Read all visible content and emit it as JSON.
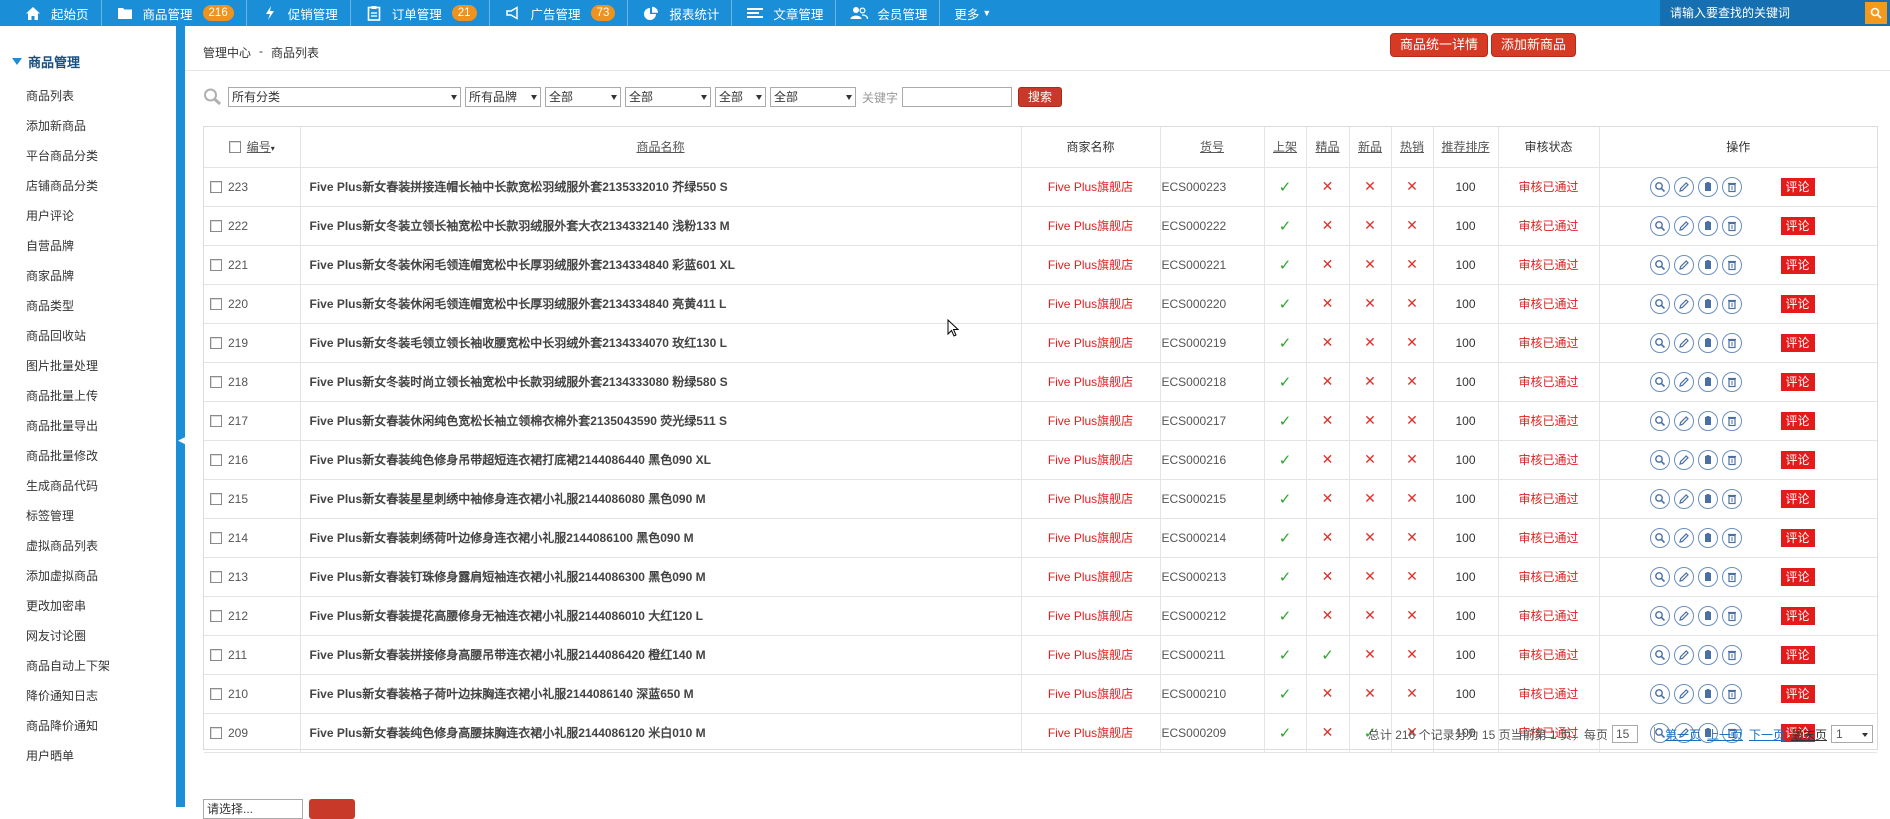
{
  "nav": {
    "items": [
      {
        "label": "起始页",
        "icon": "home-icon"
      },
      {
        "label": "商品管理",
        "icon": "folder-icon",
        "badge": "216"
      },
      {
        "label": "促销管理",
        "icon": "lightning-icon"
      },
      {
        "label": "订单管理",
        "icon": "clipboard-icon",
        "badge": "21"
      },
      {
        "label": "广告管理",
        "icon": "megaphone-icon",
        "badge": "73"
      },
      {
        "label": "报表统计",
        "icon": "pie-chart-icon"
      },
      {
        "label": "文章管理",
        "icon": "list-icon"
      },
      {
        "label": "会员管理",
        "icon": "users-icon"
      },
      {
        "label": "更多",
        "icon": "caret-down-icon"
      }
    ],
    "search_placeholder": "请输入要查找的关键词"
  },
  "sidebar": {
    "title": "商品管理",
    "items": [
      "商品列表",
      "添加新商品",
      "平台商品分类",
      "店铺商品分类",
      "用户评论",
      "自营品牌",
      "商家品牌",
      "商品类型",
      "商品回收站",
      "图片批量处理",
      "商品批量上传",
      "商品批量导出",
      "商品批量修改",
      "生成商品代码",
      "标签管理",
      "虚拟商品列表",
      "添加虚拟商品",
      "更改加密串",
      "网友讨论圈",
      "商品自动上下架",
      "降价通知日志",
      "商品降价通知",
      "用户晒单"
    ]
  },
  "breadcrumb": {
    "root": "管理中心",
    "sep": "-",
    "current": "商品列表"
  },
  "actions": {
    "detail": "商品统一详情",
    "add": "添加新商品"
  },
  "filters": {
    "category": "所有分类",
    "brand": "所有品牌",
    "f3": "全部",
    "f4": "全部",
    "f5": "全部",
    "f6": "全部",
    "keyword_label": "关键字",
    "search": "搜索"
  },
  "table": {
    "headers": {
      "id": "编号",
      "name": "商品名称",
      "shop": "商家名称",
      "sn": "货号",
      "onsale": "上架",
      "best": "精品",
      "new": "新品",
      "hot": "热销",
      "sort": "推荐排序",
      "audit": "审核状态",
      "ops": "操作"
    },
    "comment_label": "评论",
    "rows": [
      {
        "id": "223",
        "name": "Five Plus新女春装拼接连帽长袖中长款宽松羽绒服外套2135332010 芥绿550 S",
        "shop": "Five Plus旗舰店",
        "sn": "ECS000223",
        "onsale": true,
        "best": false,
        "new": false,
        "hot": false,
        "sort": "100",
        "audit": "审核已通过"
      },
      {
        "id": "222",
        "name": "Five Plus新女冬装立领长袖宽松中长款羽绒服外套大衣2134332140 浅粉133 M",
        "shop": "Five Plus旗舰店",
        "sn": "ECS000222",
        "onsale": true,
        "best": false,
        "new": false,
        "hot": false,
        "sort": "100",
        "audit": "审核已通过"
      },
      {
        "id": "221",
        "name": "Five Plus新女冬装休闲毛领连帽宽松中长厚羽绒服外套2134334840 彩蓝601 XL",
        "shop": "Five Plus旗舰店",
        "sn": "ECS000221",
        "onsale": true,
        "best": false,
        "new": false,
        "hot": false,
        "sort": "100",
        "audit": "审核已通过"
      },
      {
        "id": "220",
        "name": "Five Plus新女冬装休闲毛领连帽宽松中长厚羽绒服外套2134334840 亮黄411 L",
        "shop": "Five Plus旗舰店",
        "sn": "ECS000220",
        "onsale": true,
        "best": false,
        "new": false,
        "hot": false,
        "sort": "100",
        "audit": "审核已通过"
      },
      {
        "id": "219",
        "name": "Five Plus新女冬装毛领立领长袖收腰宽松中长羽绒外套2134334070 玫红130 L",
        "shop": "Five Plus旗舰店",
        "sn": "ECS000219",
        "onsale": true,
        "best": false,
        "new": false,
        "hot": false,
        "sort": "100",
        "audit": "审核已通过"
      },
      {
        "id": "218",
        "name": "Five Plus新女冬装时尚立领长袖宽松中长款羽绒服外套2134333080 粉绿580 S",
        "shop": "Five Plus旗舰店",
        "sn": "ECS000218",
        "onsale": true,
        "best": false,
        "new": false,
        "hot": false,
        "sort": "100",
        "audit": "审核已通过"
      },
      {
        "id": "217",
        "name": "Five Plus新女春装休闲纯色宽松长袖立领棉衣棉外套2135043590 荧光绿511 S",
        "shop": "Five Plus旗舰店",
        "sn": "ECS000217",
        "onsale": true,
        "best": false,
        "new": false,
        "hot": false,
        "sort": "100",
        "audit": "审核已通过"
      },
      {
        "id": "216",
        "name": "Five Plus新女春装纯色修身吊带超短连衣裙打底裙2144086440 黑色090 XL",
        "shop": "Five Plus旗舰店",
        "sn": "ECS000216",
        "onsale": true,
        "best": false,
        "new": false,
        "hot": false,
        "sort": "100",
        "audit": "审核已通过"
      },
      {
        "id": "215",
        "name": "Five Plus新女春装星星刺绣中袖修身连衣裙小礼服2144086080 黑色090 M",
        "shop": "Five Plus旗舰店",
        "sn": "ECS000215",
        "onsale": true,
        "best": false,
        "new": false,
        "hot": false,
        "sort": "100",
        "audit": "审核已通过"
      },
      {
        "id": "214",
        "name": "Five Plus新女春装刺绣荷叶边修身连衣裙小礼服2144086100 黑色090 M",
        "shop": "Five Plus旗舰店",
        "sn": "ECS000214",
        "onsale": true,
        "best": false,
        "new": false,
        "hot": false,
        "sort": "100",
        "audit": "审核已通过"
      },
      {
        "id": "213",
        "name": "Five Plus新女春装钉珠修身露肩短袖连衣裙小礼服2144086300 黑色090 M",
        "shop": "Five Plus旗舰店",
        "sn": "ECS000213",
        "onsale": true,
        "best": false,
        "new": false,
        "hot": false,
        "sort": "100",
        "audit": "审核已通过"
      },
      {
        "id": "212",
        "name": "Five Plus新女春装提花高腰修身无袖连衣裙小礼服2144086010 大红120 L",
        "shop": "Five Plus旗舰店",
        "sn": "ECS000212",
        "onsale": true,
        "best": false,
        "new": false,
        "hot": false,
        "sort": "100",
        "audit": "审核已通过"
      },
      {
        "id": "211",
        "name": "Five Plus新女春装拼接修身高腰吊带连衣裙小礼服2144086420 橙红140 M",
        "shop": "Five Plus旗舰店",
        "sn": "ECS000211",
        "onsale": true,
        "best": true,
        "new": false,
        "hot": false,
        "sort": "100",
        "audit": "审核已通过"
      },
      {
        "id": "210",
        "name": "Five Plus新女春装格子荷叶边抹胸连衣裙小礼服2144086140 深蓝650 M",
        "shop": "Five Plus旗舰店",
        "sn": "ECS000210",
        "onsale": true,
        "best": false,
        "new": false,
        "hot": false,
        "sort": "100",
        "audit": "审核已通过"
      },
      {
        "id": "209",
        "name": "Five Plus新女春装纯色修身高腰抹胸连衣裙小礼服2144086120 米白010 M",
        "shop": "Five Plus旗舰店",
        "sn": "ECS000209",
        "onsale": true,
        "best": false,
        "new": true,
        "hot": false,
        "sort": "100",
        "audit": "审核已通过"
      }
    ]
  },
  "pager": {
    "summary": "总计 216 个记录分为 15 页当前第 1 页，每页",
    "page_size": "15",
    "first": "第一页",
    "prev": "上一页",
    "next": "下一页",
    "last": "最末页",
    "current_page": "1"
  },
  "bottom": {
    "batch_placeholder": "请选择..."
  },
  "colors": {
    "nav_bg": "#1b8ed8",
    "accent_red": "#d63a24",
    "badge": "#f0921e",
    "check": "#2ea52e",
    "cross": "#e0312a"
  }
}
